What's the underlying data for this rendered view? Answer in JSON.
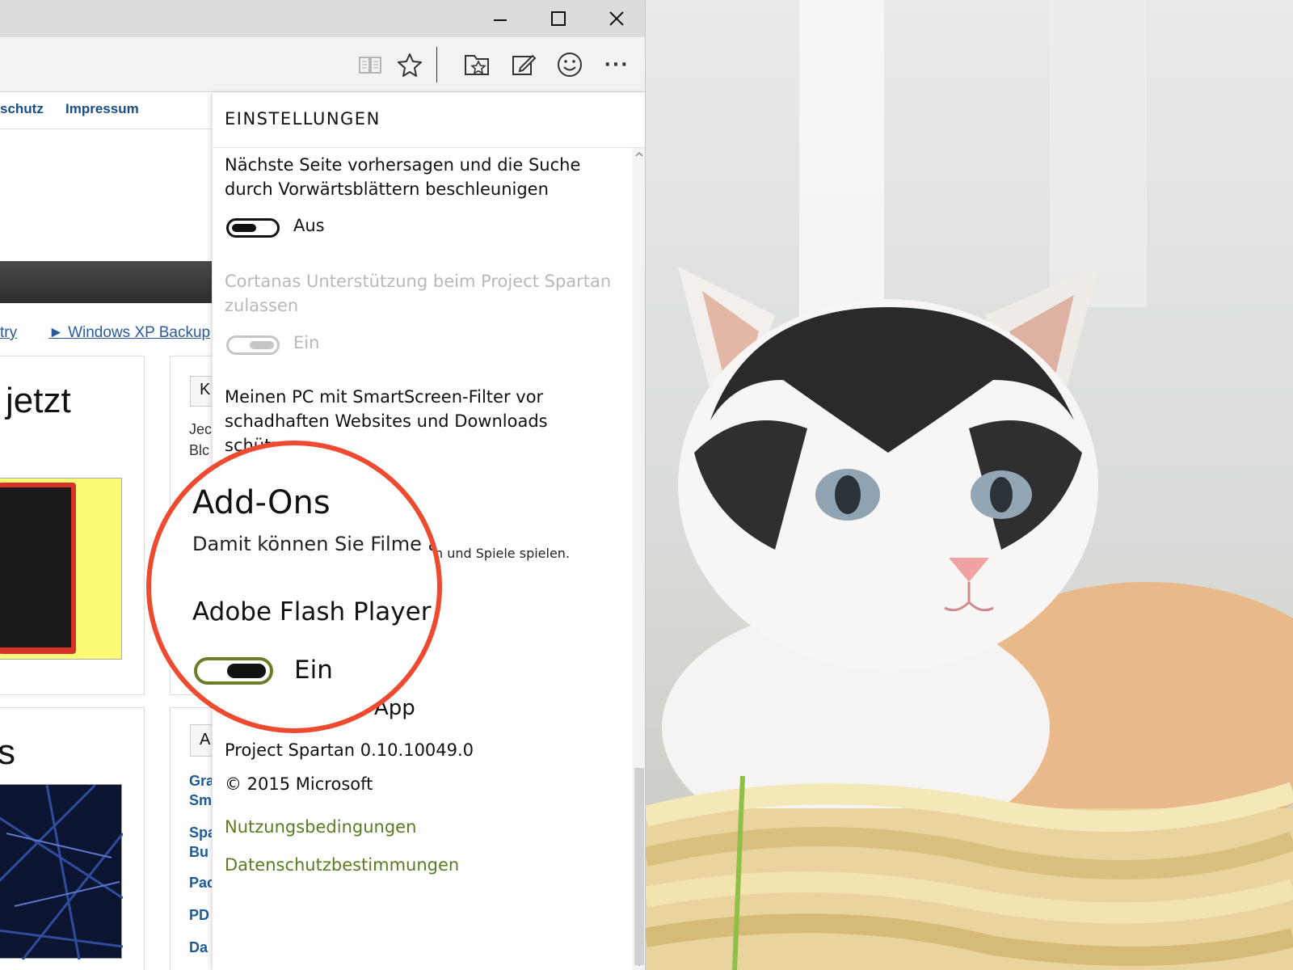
{
  "window": {
    "minimize_label": "—",
    "maximize_label": "☐",
    "close_label": "✕"
  },
  "toolbar": {
    "icons": [
      "reading-view-icon",
      "favorite-star-icon",
      "hub-icon",
      "web-note-icon",
      "feedback-smiley-icon",
      "more-icon"
    ],
    "more_label": "···"
  },
  "webpage": {
    "nav": [
      "schutz",
      "Impressum"
    ],
    "breadcrumbs": [
      "try",
      "► Windows XP Backup"
    ],
    "headline_1": "jetzt",
    "headline_2": "s",
    "side_box_1_letter": "K",
    "side_text_1": "Jec",
    "side_text_2": "Blc",
    "side_box_2_letter": "A",
    "side_links": [
      "Gra",
      "Sm",
      "Spa",
      "Bu",
      "Pac",
      "PD",
      "Da"
    ]
  },
  "settings": {
    "title": "EINSTELLUNGEN",
    "predict_text": "Nächste Seite vorhersagen und die Suche durch Vorwärtsblättern beschleunigen",
    "predict_state": "Aus",
    "cortana_text": "Cortanas Unterstützung beim Project Spartan zulassen",
    "cortana_state": "Ein",
    "smartscreen_text": "Meinen PC mit SmartScreen-Filter vor schadhaften Websites und Downloads schützen",
    "addons_desc_tail": "n und Spiele spielen.",
    "app_heading_tail": "App",
    "version": "Project Spartan 0.10.10049.0",
    "copyright": "© 2015 Microsoft",
    "link_terms": "Nutzungsbedingungen",
    "link_privacy": "Datenschutzbestimmungen"
  },
  "zoom": {
    "title": "Add-Ons",
    "description": "Damit können Sie Filme a",
    "flash_label": "Adobe Flash Player",
    "flash_state": "Ein"
  },
  "colors": {
    "accent_link": "#5b7a22",
    "callout_ring": "#ee4a30",
    "toggle_on_border": "#6a7d29"
  }
}
